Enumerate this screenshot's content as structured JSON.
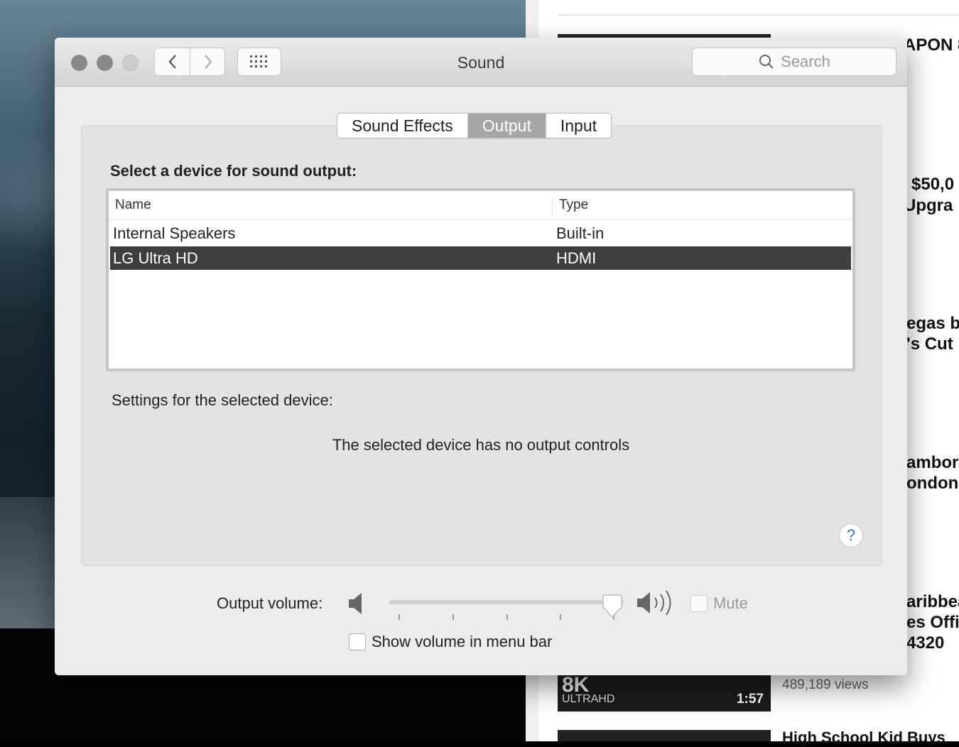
{
  "background": {
    "youtube": {
      "titles": [
        "APON 8",
        "$50,0",
        "Upgra",
        "egas b",
        "'s Cut",
        "ambor",
        "ondon",
        "aribbea",
        "es Offi",
        "4320"
      ],
      "thumb_logo": "8K",
      "thumb_logo_sub": "ULTRAHD",
      "thumb_duration": "1:57",
      "views": "489,189 views",
      "next_title": "High School Kid Buys"
    }
  },
  "window": {
    "title": "Sound",
    "search_placeholder": "Search"
  },
  "tabs": [
    {
      "label": "Sound Effects",
      "active": false
    },
    {
      "label": "Output",
      "active": true
    },
    {
      "label": "Input",
      "active": false
    }
  ],
  "output": {
    "heading": "Select a device for sound output:",
    "columns": {
      "name": "Name",
      "type": "Type"
    },
    "devices": [
      {
        "name": "Internal Speakers",
        "type": "Built-in",
        "selected": false
      },
      {
        "name": "LG Ultra HD",
        "type": "HDMI",
        "selected": true
      }
    ],
    "settings_label": "Settings for the selected device:",
    "no_controls_message": "The selected device has no output controls",
    "help_label": "?"
  },
  "volume": {
    "label": "Output volume:",
    "level": 0.95,
    "mute_label": "Mute",
    "mute_checked": false,
    "show_in_menu_bar_label": "Show volume in menu bar",
    "show_in_menu_bar_checked": false
  },
  "colors": {
    "selected_row": "#3e3e3e",
    "active_tab": "#a6a6a6",
    "help_accent": "#2f7bd9"
  }
}
